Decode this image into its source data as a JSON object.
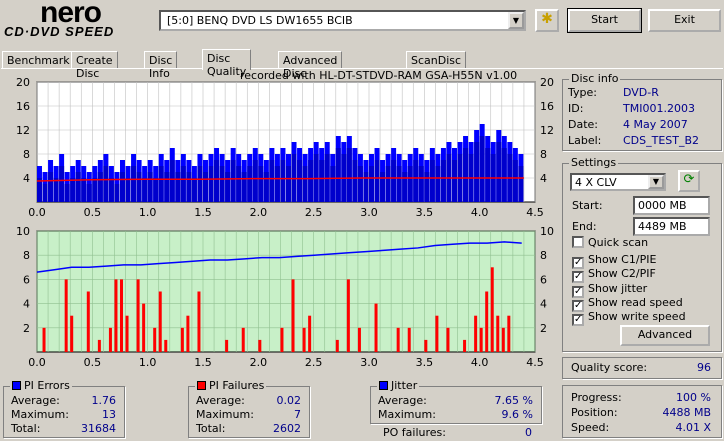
{
  "app": {
    "logo_top": "nero",
    "logo_bottom": "CD·DVD SPEED"
  },
  "toolbar": {
    "drive": "[5:0]  BENQ DVD LS DW1655 BCIB",
    "start": "Start",
    "exit": "Exit"
  },
  "tabs": [
    "Benchmark",
    "Create Disc",
    "Disc Info",
    "Disc Quality",
    "Advanced Disc Quality",
    "ScanDisc"
  ],
  "active_tab": "Disc Quality",
  "recorded_with": "recorded with HL-DT-STDVD-RAM GSA-H55N v1.00",
  "disc_info": {
    "title": "Disc info",
    "type_label": "Type:",
    "type": "DVD-R",
    "id_label": "ID:",
    "id": "TMI001.2003",
    "date_label": "Date:",
    "date": "4 May 2007",
    "label_label": "Label:",
    "label": "CDS_TEST_B2"
  },
  "settings": {
    "title": "Settings",
    "speed": "4 X CLV",
    "start_label": "Start:",
    "start": "0000 MB",
    "end_label": "End:",
    "end": "4489 MB",
    "checks": [
      {
        "label": "Quick scan",
        "checked": false
      },
      {
        "label": "Show C1/PIE",
        "checked": true
      },
      {
        "label": "Show C2/PIF",
        "checked": true
      },
      {
        "label": "Show jitter",
        "checked": true
      },
      {
        "label": "Show read speed",
        "checked": true
      },
      {
        "label": "Show write speed",
        "checked": true
      }
    ],
    "advanced": "Advanced"
  },
  "quality": {
    "label": "Quality score:",
    "value": "96"
  },
  "progress": {
    "progress_label": "Progress:",
    "progress": "100 %",
    "position_label": "Position:",
    "position": "4488 MB",
    "speed_label": "Speed:",
    "speed": "4.01 X"
  },
  "pi_errors": {
    "title": "PI Errors",
    "color": "#0000ff",
    "avg_label": "Average:",
    "avg": "1.76",
    "max_label": "Maximum:",
    "max": "13",
    "total_label": "Total:",
    "total": "31684"
  },
  "pi_failures": {
    "title": "PI Failures",
    "color": "#ff0000",
    "avg_label": "Average:",
    "avg": "0.02",
    "max_label": "Maximum:",
    "max": "7",
    "total_label": "Total:",
    "total": "2602"
  },
  "jitter": {
    "title": "Jitter",
    "color": "#0000ff",
    "avg_label": "Average:",
    "avg": "7.65 %",
    "max_label": "Maximum:",
    "max": "9.6 %",
    "po_label": "PO failures:",
    "po": "0"
  },
  "chart_data": [
    {
      "type": "bar",
      "name": "PI Errors",
      "ylim": [
        0,
        20
      ],
      "xlim": [
        0,
        4.5
      ],
      "yticks": [
        20,
        16,
        12,
        8,
        4
      ],
      "xticks": [
        "0.0",
        "0.5",
        "1.0",
        "1.5",
        "2.0",
        "2.5",
        "3.0",
        "3.5",
        "4.0",
        "4.5"
      ],
      "x_step": 0.05,
      "values": [
        6,
        5,
        7,
        6,
        8,
        5,
        6,
        7,
        6,
        5,
        6,
        7,
        8,
        6,
        5,
        7,
        6,
        8,
        7,
        6,
        7,
        6,
        8,
        7,
        9,
        7,
        8,
        7,
        6,
        8,
        7,
        8,
        9,
        8,
        7,
        9,
        8,
        7,
        8,
        9,
        8,
        7,
        9,
        8,
        9,
        8,
        10,
        9,
        8,
        9,
        10,
        9,
        10,
        8,
        11,
        10,
        11,
        9,
        8,
        7,
        8,
        9,
        7,
        8,
        9,
        8,
        7,
        8,
        9,
        8,
        7,
        9,
        8,
        9,
        10,
        9,
        10,
        11,
        10,
        12,
        13,
        11,
        10,
        12,
        11,
        10,
        9,
        8
      ],
      "avg_line": [
        3.5,
        3.7,
        3.8,
        3.8,
        3.9,
        3.9,
        4.0,
        4.0,
        4.0,
        4.0
      ]
    },
    {
      "type": "bar",
      "name": "PI Failures / Jitter",
      "ylim": [
        0,
        10
      ],
      "xlim": [
        0,
        4.5
      ],
      "yticks": [
        10,
        8,
        6,
        4,
        2
      ],
      "xticks": [
        "0.0",
        "0.5",
        "1.0",
        "1.5",
        "2.0",
        "2.5",
        "3.0",
        "3.5",
        "4.0",
        "4.5"
      ],
      "pif": [
        [
          0.05,
          2
        ],
        [
          0.25,
          6
        ],
        [
          0.3,
          3
        ],
        [
          0.45,
          5
        ],
        [
          0.55,
          1
        ],
        [
          0.65,
          2
        ],
        [
          0.7,
          6
        ],
        [
          0.75,
          6
        ],
        [
          0.8,
          3
        ],
        [
          0.9,
          6
        ],
        [
          0.95,
          4
        ],
        [
          1.05,
          2
        ],
        [
          1.1,
          5
        ],
        [
          1.15,
          1
        ],
        [
          1.3,
          2
        ],
        [
          1.35,
          3
        ],
        [
          1.45,
          5
        ],
        [
          1.7,
          1
        ],
        [
          1.85,
          2
        ],
        [
          2.0,
          1
        ],
        [
          2.2,
          2
        ],
        [
          2.3,
          6
        ],
        [
          2.4,
          2
        ],
        [
          2.45,
          3
        ],
        [
          2.7,
          1
        ],
        [
          2.8,
          6
        ],
        [
          2.9,
          2
        ],
        [
          3.05,
          4
        ],
        [
          3.25,
          2
        ],
        [
          3.35,
          2
        ],
        [
          3.5,
          1
        ],
        [
          3.6,
          3
        ],
        [
          3.7,
          2
        ],
        [
          3.85,
          1
        ],
        [
          3.95,
          3
        ],
        [
          4.0,
          2
        ],
        [
          4.05,
          5
        ],
        [
          4.1,
          7
        ],
        [
          4.15,
          3
        ],
        [
          4.2,
          2
        ],
        [
          4.25,
          3
        ]
      ],
      "jitter": [
        6.6,
        6.8,
        7.0,
        7.0,
        7.1,
        7.2,
        7.2,
        7.3,
        7.4,
        7.5,
        7.6,
        7.6,
        7.7,
        7.8,
        7.8,
        7.9,
        8.0,
        8.1,
        8.2,
        8.3,
        8.4,
        8.5,
        8.6,
        8.8,
        8.9,
        9.0,
        9.0,
        9.1,
        9.0
      ]
    }
  ]
}
